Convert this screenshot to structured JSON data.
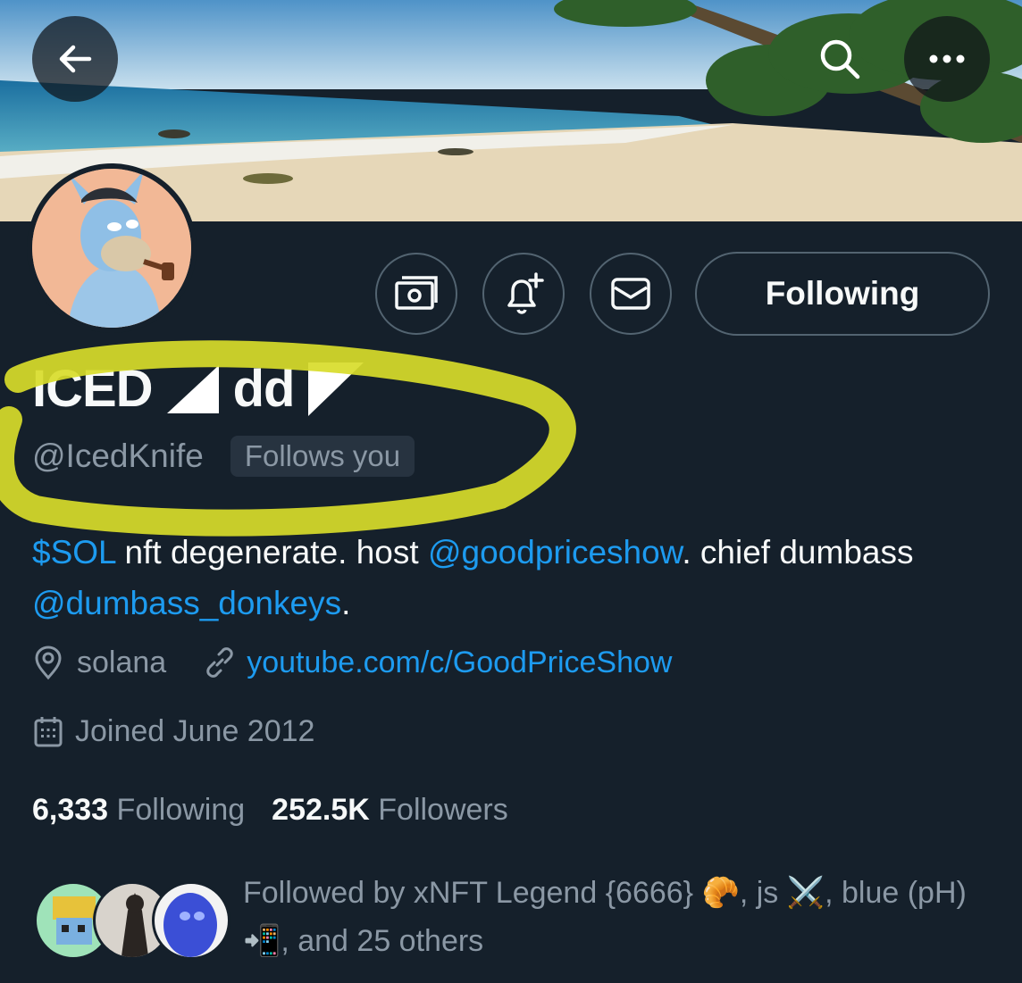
{
  "header": {
    "back_icon": "arrow-left-icon",
    "search_icon": "search-icon",
    "more_icon": "more-horizontal-icon"
  },
  "profile": {
    "display_name_part1": "ICED",
    "display_name_part2": "dd",
    "handle": "@IcedKnife",
    "follows_you_badge": "Follows you",
    "bio": {
      "seg1": "$SOL",
      "seg2": " nft degenerate. host ",
      "mention1": "@goodpriceshow",
      "seg3": ". chief dumbass ",
      "mention2": "@dumbass_donkeys",
      "seg4": "."
    },
    "location": "solana",
    "website": "youtube.com/c/GoodPriceShow",
    "joined": "Joined June 2012",
    "following_count": "6,333",
    "following_label": "Following",
    "followers_count": "252.5K",
    "followers_label": "Followers"
  },
  "actions": {
    "tip_icon": "money-icon",
    "notify_icon": "bell-plus-icon",
    "message_icon": "envelope-icon",
    "following_button": "Following"
  },
  "followed_by": {
    "prefix": "Followed by xNFT Legend {6666} ",
    "emoji1": "🥐",
    "mid1": ", js ",
    "emoji2": "⚔️",
    "mid2": ", blue (pH) ",
    "emoji3": "📲",
    "suffix": ", and 25 others"
  },
  "colors": {
    "background": "#15202b",
    "link": "#1d9bf0",
    "secondary_text": "#8b98a5",
    "highlight": "#d8dc2a"
  }
}
